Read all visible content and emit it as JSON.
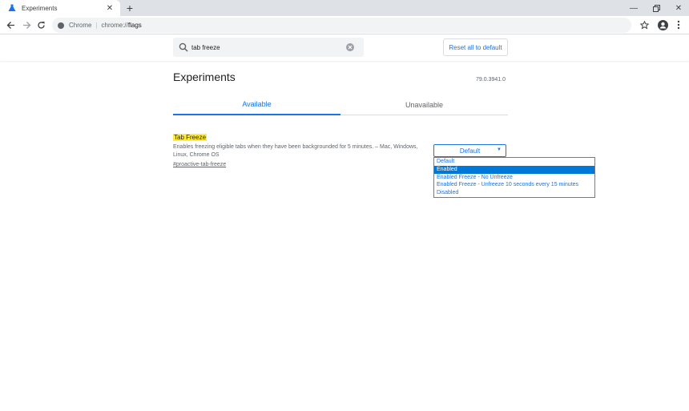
{
  "tab": {
    "title": "Experiments"
  },
  "omnibox": {
    "site_label": "Chrome",
    "scheme": "chrome://",
    "host": "flags"
  },
  "search": {
    "value": "tab freeze"
  },
  "reset_label": "Reset all to default",
  "page": {
    "title": "Experiments",
    "version": "79.0.3941.0"
  },
  "tabs": {
    "available": "Available",
    "unavailable": "Unavailable"
  },
  "experiment": {
    "name": "Tab Freeze",
    "description": "Enables freezing eligible tabs when they have been backgrounded for 5 minutes. – Mac, Windows, Linux, Chrome OS",
    "link": "#proactive-tab-freeze",
    "selected": "Default",
    "options": [
      "Default",
      "Enabled",
      "Enabled Freeze - No Unfreeze",
      "Enabled Freeze - Unfreeze 10 seconds every 15 minutes",
      "Disabled"
    ]
  },
  "colors": {
    "accent": "#1a73e8",
    "highlight": "#ffeb3b",
    "selection": "#0078d7"
  }
}
